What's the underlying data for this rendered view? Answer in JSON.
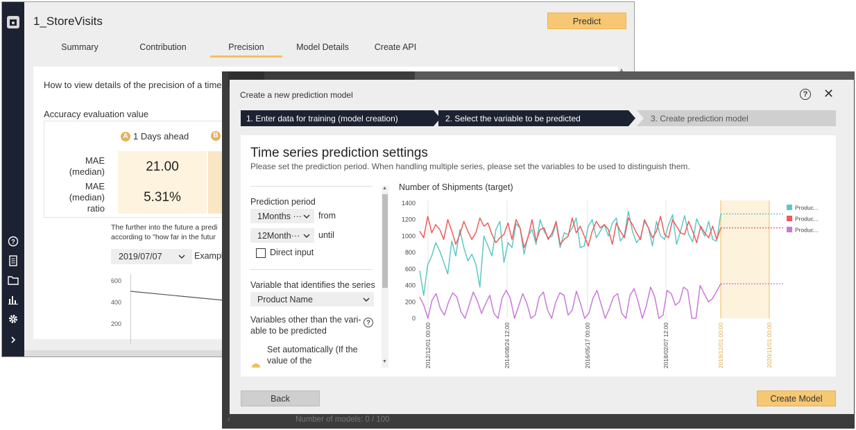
{
  "app": {
    "title": "1_StoreVisits",
    "predict_label": "Predict",
    "tabs": [
      {
        "label": "Summary"
      },
      {
        "label": "Contribution"
      },
      {
        "label": "Precision"
      },
      {
        "label": "Model Details"
      },
      {
        "label": "Create API"
      }
    ],
    "active_tab": "Precision",
    "howto_text": "How to view details of the precision of a time se",
    "accuracy_label": "Accuracy evaluation value",
    "badge_a": "A",
    "badge_b": "B",
    "days_ahead_label": "1 Days ahead",
    "metrics": [
      {
        "name": "MAE (median)",
        "value": "21.00"
      },
      {
        "name": "MAE (median) ratio",
        "value": "5.31%"
      }
    ],
    "further_text_1": "The further into the future a predi",
    "further_text_2": "according to \"how far in the futur",
    "date_select_value": "2019/07/07",
    "example_text": "Exampl",
    "mini_chart_y_labels": [
      "600",
      "400",
      "200"
    ],
    "rail_icons": [
      "app-logo-icon",
      "help-icon",
      "document-icon",
      "folder-icon",
      "bar-chart-icon",
      "gear-icon",
      "chevron-right-icon"
    ]
  },
  "overlay": {
    "models_count_text": "Number of models: 0 / 100"
  },
  "modal": {
    "title": "Create a new prediction model",
    "steps": [
      {
        "label": "1. Enter data for training (model creation)",
        "state": "done"
      },
      {
        "label": "2. Select the variable to be predicted",
        "state": "active"
      },
      {
        "label": "3. Create prediction model",
        "state": "pending"
      }
    ],
    "heading": "Time series prediction settings",
    "subheading": "Please set the prediction period. When handling multiple series, please set the variables to be used to distinguish them.",
    "settings": {
      "period_label": "Prediction period",
      "from_value": "1Months",
      "from_word": "from",
      "until_value": "12Month",
      "until_word": "until",
      "direct_input_label": "Direct input",
      "series_label": "Variable that identifies the series",
      "series_value": "Product Name",
      "other_vars_label": "Variables other than the vari-able to be predicted",
      "set_auto_label": "Set automatically (If the value of the"
    },
    "back_label": "Back",
    "create_label": "Create Model"
  },
  "chart_data": {
    "type": "line",
    "title": "Number of Shipments (target)",
    "ylim": [
      0,
      1400
    ],
    "y_ticks": [
      "0",
      "200",
      "400",
      "600",
      "800",
      "1000",
      "1200",
      "1400"
    ],
    "x_tick_labels": [
      "2012/12/01 00:00",
      "2014/08/24 12:00",
      "2016/05/17 00:00",
      "2018/02/07 12:00",
      "2019/12/01 00:00",
      "2020/11/01 00:00"
    ],
    "grid": true,
    "legend_position": "right",
    "prediction_region": [
      "2019/12/01 00:00",
      "2020/11/01 00:00"
    ],
    "series": [
      {
        "name": "Produc...",
        "color": "#5cc8c4",
        "values": [
          580,
          280,
          650,
          760,
          920,
          820,
          680,
          540,
          940,
          760,
          1080,
          860,
          700,
          780,
          660,
          380,
          1000,
          880,
          760,
          1080,
          1180,
          680,
          920,
          860,
          1150,
          1100,
          780,
          1000,
          1080,
          900,
          1200,
          1060,
          980,
          1000,
          1160,
          860,
          1040,
          1020,
          1100,
          1220,
          860,
          880,
          1120,
          1200,
          980,
          1060,
          1140,
          1000,
          1160,
          1220,
          940,
          1010,
          1300,
          1060,
          920,
          980,
          1180,
          1100,
          880,
          1180,
          1000,
          960,
          1140,
          1260,
          900,
          1060,
          1250,
          1020,
          930,
          1210,
          1100,
          1000,
          1180,
          960,
          940,
          1270
        ],
        "forecast": 1270
      },
      {
        "name": "Produc...",
        "color": "#f05a5a",
        "values": [
          1060,
          980,
          1240,
          1040,
          1140,
          1080,
          960,
          1200,
          1060,
          900,
          1020,
          1180,
          1060,
          960,
          1040,
          1220,
          1120,
          1160,
          1020,
          920,
          980,
          1020,
          1160,
          960,
          1200,
          1100,
          860,
          980,
          1200,
          940,
          1080,
          1100,
          960,
          1040,
          1180,
          900,
          960,
          1000,
          1220,
          1040,
          1120,
          1000,
          880,
          1060,
          1180,
          1100,
          1140,
          1080,
          900,
          1160,
          1060,
          980,
          1220,
          1140,
          1040,
          960,
          1200,
          1100,
          980,
          1060,
          1240,
          1020,
          980,
          1200,
          1120,
          1040,
          1020,
          1180,
          1060,
          920,
          1120,
          1040,
          980,
          1120,
          960,
          1100
        ],
        "forecast": 1100
      },
      {
        "name": "Produc...",
        "color": "#c879d9",
        "values": [
          260,
          160,
          0,
          220,
          300,
          120,
          40,
          200,
          310,
          260,
          80,
          0,
          160,
          320,
          210,
          60,
          180,
          280,
          60,
          0,
          250,
          340,
          240,
          0,
          150,
          300,
          180,
          0,
          40,
          260,
          320,
          100,
          0,
          200,
          310,
          280,
          40,
          100,
          330,
          180,
          0,
          60,
          240,
          340,
          170,
          0,
          120,
          260,
          300,
          60,
          0,
          280,
          360,
          200,
          0,
          160,
          380,
          260,
          0,
          40,
          340,
          300,
          160,
          200,
          380,
          340,
          0,
          0,
          400,
          300,
          200,
          240,
          330,
          420
        ],
        "forecast": 420
      }
    ]
  }
}
